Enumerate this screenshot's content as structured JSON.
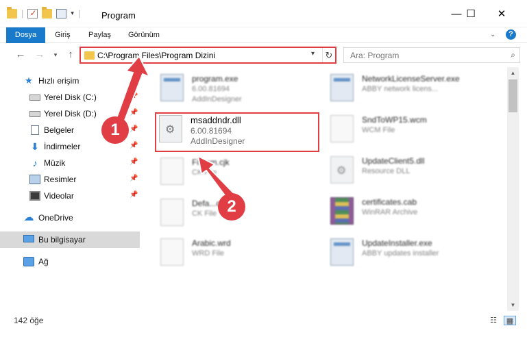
{
  "window": {
    "title": "Program",
    "controls": [
      "—",
      "☐",
      "✕"
    ]
  },
  "ribbon": {
    "tabs": [
      "Dosya",
      "Giriş",
      "Paylaş",
      "Görünüm"
    ]
  },
  "address": {
    "path": "C:\\Program Files\\Program Dizini"
  },
  "search": {
    "placeholder": "Ara: Program"
  },
  "nav": {
    "quick_access": "Hızlı erişim",
    "items": [
      {
        "label": "Yerel Disk (C:)",
        "icon": "disk-icon",
        "pinned": true
      },
      {
        "label": "Yerel Disk (D:)",
        "icon": "disk-icon",
        "pinned": true
      },
      {
        "label": "Belgeler",
        "icon": "documents-icon",
        "pinned": true
      },
      {
        "label": "İndirmeler",
        "icon": "download-icon",
        "pinned": true
      },
      {
        "label": "Müzik",
        "icon": "music-icon",
        "pinned": true
      },
      {
        "label": "Resimler",
        "icon": "pictures-icon",
        "pinned": true
      },
      {
        "label": "Videolar",
        "icon": "videos-icon",
        "pinned": true
      }
    ],
    "onedrive": "OneDrive",
    "this_pc": "Bu bilgisayar",
    "network": "Ağ"
  },
  "files": {
    "left": [
      {
        "name": "program.exe",
        "meta1": "6.00.81694",
        "meta2": "AddInDesigner",
        "icon": "app"
      },
      {
        "name": "msaddndr.dll",
        "meta1": "6.00.81694",
        "meta2": "AddInDesigner",
        "icon": "gear",
        "highlight": true
      },
      {
        "name": "Fi...em.cjk",
        "meta1": "CK File",
        "meta2": "",
        "icon": "doc"
      },
      {
        "name": "Defa...cjk",
        "meta1": "CK File",
        "meta2": "",
        "icon": "doc"
      },
      {
        "name": "Arabic.wrd",
        "meta1": "WRD File",
        "meta2": "",
        "icon": "doc"
      }
    ],
    "right": [
      {
        "name": "NetworkLicenseServer.exe",
        "meta1": "ABBY network licens...",
        "meta2": "",
        "icon": "app"
      },
      {
        "name": "SndToWP15.wcm",
        "meta1": "WCM File",
        "meta2": "",
        "icon": "doc"
      },
      {
        "name": "UpdateClient5.dll",
        "meta1": "Resource DLL",
        "meta2": "",
        "icon": "gear"
      },
      {
        "name": "certificates.cab",
        "meta1": "WinRAR Archive",
        "meta2": "",
        "icon": "rar"
      },
      {
        "name": "UpdateInstaller.exe",
        "meta1": "ABBY updates installer",
        "meta2": "",
        "icon": "app"
      }
    ]
  },
  "status": {
    "count": "142 öğe"
  },
  "annotations": {
    "badge1": "1",
    "badge2": "2",
    "accent": "#e03d45"
  }
}
